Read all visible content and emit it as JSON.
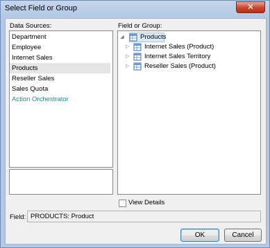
{
  "window": {
    "title": "Select Field or Group",
    "close_glyph": "✕"
  },
  "data_sources": {
    "label": "Data Sources:",
    "items": [
      {
        "label": "Department",
        "selected": false,
        "link": false
      },
      {
        "label": "Employee",
        "selected": false,
        "link": false
      },
      {
        "label": "Internet Sales",
        "selected": false,
        "link": false
      },
      {
        "label": "Products",
        "selected": true,
        "link": false
      },
      {
        "label": "Reseller Sales",
        "selected": false,
        "link": false
      },
      {
        "label": "Sales Quota",
        "selected": false,
        "link": false
      },
      {
        "label": "Action Orchestrator",
        "selected": false,
        "link": true
      }
    ]
  },
  "field_or_group": {
    "label": "Field or Group:",
    "root": {
      "label": "Products",
      "icon": "table-icon",
      "expanded": true
    },
    "children": [
      {
        "label": "Internet Sales (Product)",
        "icon": "table-icon"
      },
      {
        "label": "Internet Sales Territory",
        "icon": "table-icon"
      },
      {
        "label": "Reseller Sales (Product)",
        "icon": "table-icon"
      }
    ]
  },
  "view_details": {
    "label": "View Details",
    "checked": false
  },
  "field": {
    "label": "Field:",
    "value": "PRODUCTS: Product"
  },
  "buttons": {
    "ok": "OK",
    "cancel": "Cancel"
  },
  "colors": {
    "link": "#1f8a8a",
    "selection": "#dceaf8",
    "title_bar": "#c5d6ec"
  }
}
